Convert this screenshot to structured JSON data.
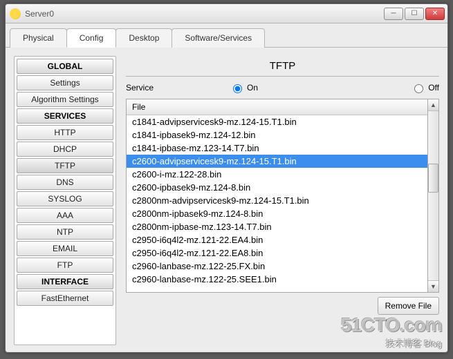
{
  "window": {
    "title": "Server0"
  },
  "tabs": [
    {
      "label": "Physical"
    },
    {
      "label": "Config"
    },
    {
      "label": "Desktop"
    },
    {
      "label": "Software/Services"
    }
  ],
  "sidebar": {
    "sections": [
      {
        "head": "GLOBAL",
        "items": [
          "Settings",
          "Algorithm Settings"
        ]
      },
      {
        "head": "SERVICES",
        "items": [
          "HTTP",
          "DHCP",
          "TFTP",
          "DNS",
          "SYSLOG",
          "AAA",
          "NTP",
          "EMAIL",
          "FTP"
        ]
      },
      {
        "head": "INTERFACE",
        "items": [
          "FastEthernet"
        ]
      }
    ],
    "selected": "TFTP"
  },
  "panel": {
    "title": "TFTP",
    "service_label": "Service",
    "on_label": "On",
    "off_label": "Off",
    "service_state": "On",
    "file_header": "File",
    "remove_label": "Remove File",
    "selected_file": "c2600-advipservicesk9-mz.124-15.T1.bin",
    "files": [
      "c1841-advipservicesk9-mz.124-15.T1.bin",
      "c1841-ipbasek9-mz.124-12.bin",
      "c1841-ipbase-mz.123-14.T7.bin",
      "c2600-advipservicesk9-mz.124-15.T1.bin",
      "c2600-i-mz.122-28.bin",
      "c2600-ipbasek9-mz.124-8.bin",
      "c2800nm-advipservicesk9-mz.124-15.T1.bin",
      "c2800nm-ipbasek9-mz.124-8.bin",
      "c2800nm-ipbase-mz.123-14.T7.bin",
      "c2950-i6q4l2-mz.121-22.EA4.bin",
      "c2950-i6q4l2-mz.121-22.EA8.bin",
      "c2960-lanbase-mz.122-25.FX.bin",
      "c2960-lanbase-mz.122-25.SEE1.bin"
    ]
  },
  "watermark": {
    "line1": "51CTO.com",
    "line2": "技术博客    Blog"
  }
}
